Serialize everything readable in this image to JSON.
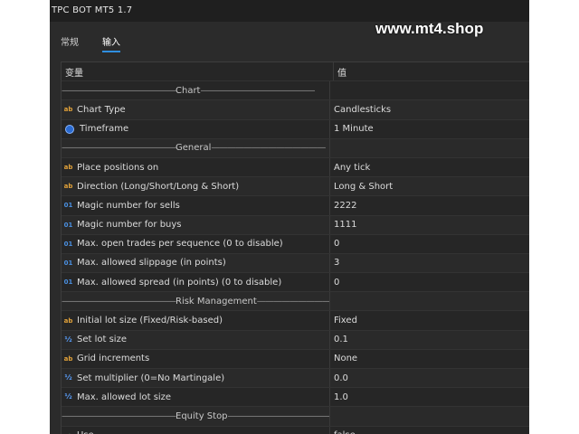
{
  "window": {
    "title": "TPC BOT MT5 1.7"
  },
  "tabs": [
    {
      "label": "常规",
      "active": false
    },
    {
      "label": "输入",
      "active": true
    }
  ],
  "watermark": "www.mt4.shop",
  "table": {
    "header": {
      "param": "变量",
      "value": "值"
    },
    "rows": [
      {
        "type": "separator",
        "label": "Chart"
      },
      {
        "type": "param",
        "icon": "ab",
        "label": "Chart Type",
        "value": "Candlesticks"
      },
      {
        "type": "param",
        "icon": "clock",
        "label": "Timeframe",
        "value": "1 Minute"
      },
      {
        "type": "separator",
        "label": "General"
      },
      {
        "type": "param",
        "icon": "ab",
        "label": "Place positions on",
        "value": "Any tick"
      },
      {
        "type": "param",
        "icon": "ab",
        "label": "Direction (Long/Short/Long & Short)",
        "value": "Long & Short"
      },
      {
        "type": "param",
        "icon": "01",
        "label": "Magic number for sells",
        "value": "2222"
      },
      {
        "type": "param",
        "icon": "01",
        "label": "Magic number for buys",
        "value": "1111"
      },
      {
        "type": "param",
        "icon": "01",
        "label": "Max. open trades per sequence (0 to disable)",
        "value": "0"
      },
      {
        "type": "param",
        "icon": "01",
        "label": "Max. allowed slippage (in points)",
        "value": "3"
      },
      {
        "type": "param",
        "icon": "01",
        "label": "Max. allowed spread (in points) (0 to disable)",
        "value": "0"
      },
      {
        "type": "separator",
        "label": "Risk Management"
      },
      {
        "type": "param",
        "icon": "ab",
        "label": "Initial lot size (Fixed/Risk-based)",
        "value": "Fixed"
      },
      {
        "type": "param",
        "icon": "half",
        "label": "Set lot size",
        "value": "0.1"
      },
      {
        "type": "param",
        "icon": "ab",
        "label": "Grid increments",
        "value": "None"
      },
      {
        "type": "param",
        "icon": "half",
        "label": "Set multiplier (0=No Martingale)",
        "value": "0.0"
      },
      {
        "type": "param",
        "icon": "half",
        "label": "Max. allowed lot size",
        "value": "1.0"
      },
      {
        "type": "separator",
        "label": "Equity Stop"
      },
      {
        "type": "param",
        "icon": "bool",
        "label": "Use",
        "value": "false"
      }
    ]
  },
  "icons": {
    "ab": {
      "glyph": "ab",
      "name": "string-param-icon"
    },
    "01": {
      "glyph": "01",
      "name": "integer-param-icon"
    },
    "half": {
      "glyph": "½",
      "name": "double-param-icon"
    },
    "clock": {
      "glyph": "",
      "name": "timeframe-icon"
    },
    "bool": {
      "glyph": "✓",
      "name": "bool-param-icon"
    }
  },
  "colors": {
    "background": "#2b2b2b",
    "accent": "#2f8fe0",
    "text": "#dcdcdc"
  }
}
